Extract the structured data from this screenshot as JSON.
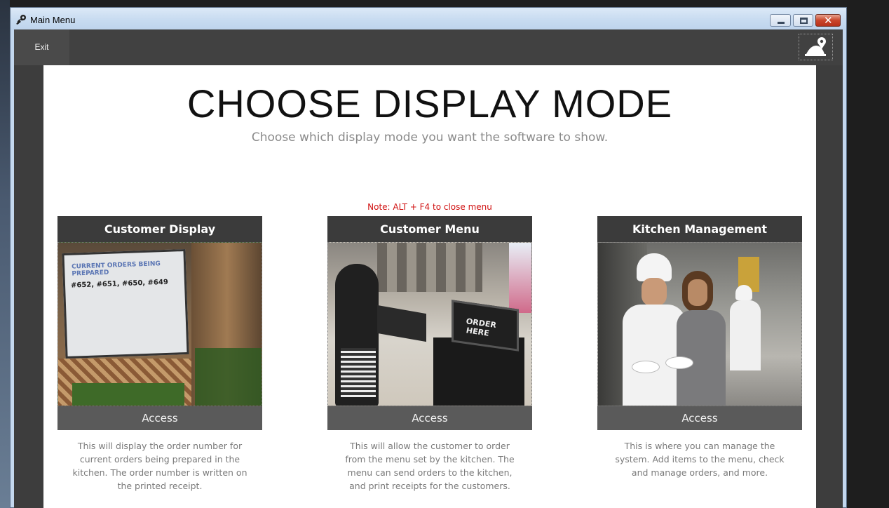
{
  "window": {
    "title": "Main Menu",
    "controls": {
      "minimize": "minimize",
      "maximize": "maximize",
      "close": "✕"
    }
  },
  "toolbar": {
    "exit_label": "Exit"
  },
  "main": {
    "heading": "CHOOSE DISPLAY MODE",
    "subheading": "Choose which display mode you want the software to show.",
    "note": "Note: ALT + F4 to close menu"
  },
  "cards": [
    {
      "title": "Customer Display",
      "access_label": "Access",
      "description": "This will display the order number for current orders being prepared in the kitchen. The order number is written on the printed receipt.",
      "image": {
        "line1": "CURRENT ORDERS BEING PREPARED",
        "line2": "#652, #651, #650, #649"
      }
    },
    {
      "title": "Customer Menu",
      "access_label": "Access",
      "description": "This will allow the customer to order from the menu set by the kitchen. The menu can send orders to the kitchen, and print receipts for the customers.",
      "image": {
        "kiosk_text": "ORDER HERE"
      }
    },
    {
      "title": "Kitchen Management",
      "access_label": "Access",
      "description": "This is where you can manage the system. Add items to the menu, check and manage orders, and more."
    }
  ],
  "colors": {
    "note": "#d01010",
    "card_header": "#3b3b3b",
    "card_access": "#5a5a5a",
    "toolbar": "#414141"
  }
}
